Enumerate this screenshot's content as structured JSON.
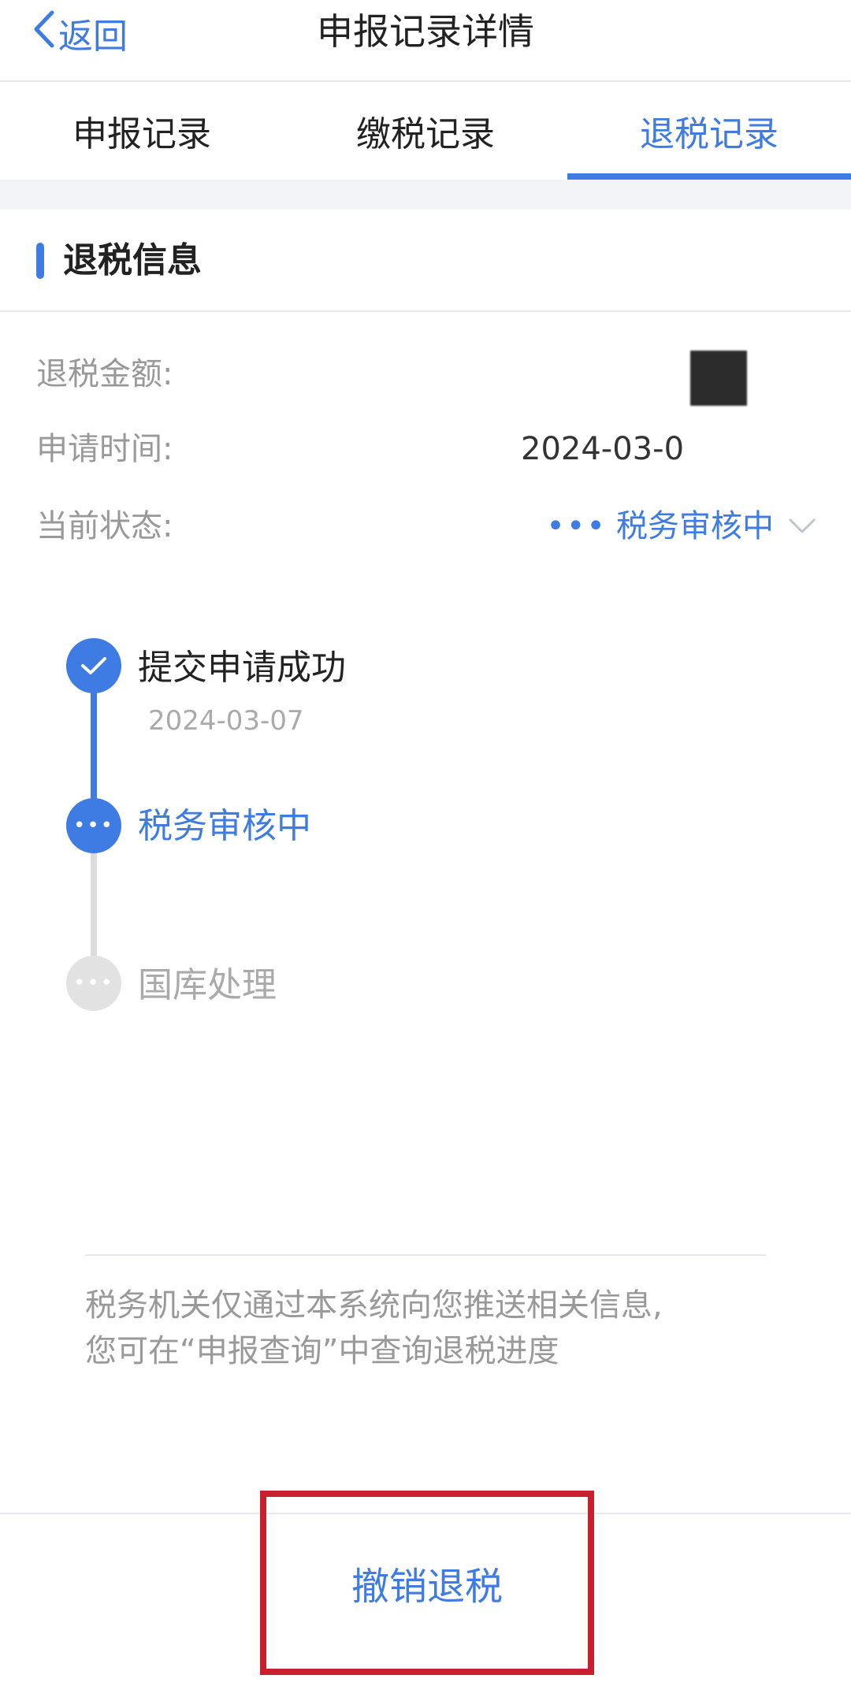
{
  "header": {
    "back_label": "返回",
    "title": "申报记录详情"
  },
  "tabs": [
    {
      "label": "申报记录",
      "active": false
    },
    {
      "label": "缴税记录",
      "active": false
    },
    {
      "label": "退税记录",
      "active": true
    }
  ],
  "section": {
    "title": "退税信息"
  },
  "info": {
    "amount_label": "退税金额:",
    "apply_time_label": "申请时间:",
    "apply_time_value": "2024-03-0",
    "status_label": "当前状态:",
    "status_value": "税务审核中"
  },
  "timeline": [
    {
      "label": "提交申请成功",
      "date": "2024-03-07",
      "state": "done"
    },
    {
      "label": "税务审核中",
      "date": "",
      "state": "current"
    },
    {
      "label": "国库处理",
      "date": "",
      "state": "pending"
    }
  ],
  "notice": {
    "line1": "税务机关仅通过本系统向您推送相关信息,",
    "line2": "您可在“申报查询”中查询退税进度"
  },
  "actions": {
    "cancel_refund_label": "撤销退税"
  },
  "colors": {
    "accent": "#3e7ce4",
    "highlight_border": "#c8202f",
    "muted": "#999999"
  }
}
